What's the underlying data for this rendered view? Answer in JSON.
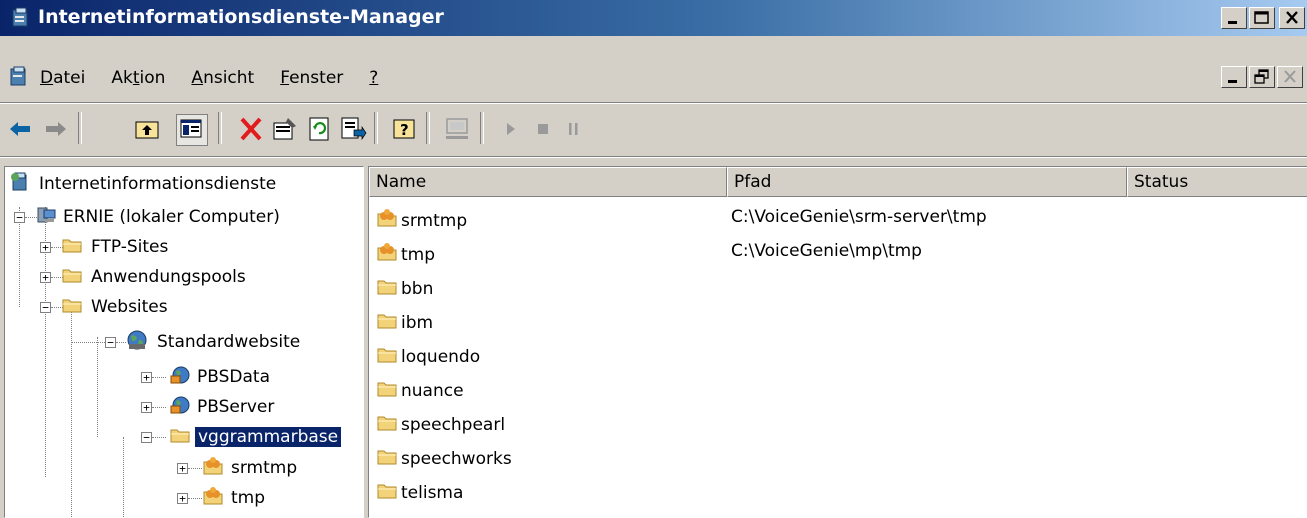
{
  "window": {
    "title": "Internetinformationsdienste-Manager"
  },
  "menubar": {
    "items": [
      {
        "label": "Datei",
        "accel": "D",
        "rest": "atei",
        "pre": ""
      },
      {
        "label": "Aktion",
        "pre": "Ak",
        "accel": "t",
        "rest": "ion"
      },
      {
        "label": "Ansicht",
        "pre": "",
        "accel": "A",
        "rest": "nsicht"
      },
      {
        "label": "Fenster",
        "pre": "",
        "accel": "F",
        "rest": "enster"
      },
      {
        "label": "?",
        "pre": "",
        "accel": "?",
        "rest": ""
      }
    ]
  },
  "toolbar": {
    "buttons": [
      "back-arrow-icon",
      "forward-arrow-icon",
      "up-folder-icon",
      "show-tree-icon",
      "delete-icon",
      "properties-icon",
      "refresh-icon",
      "export-list-icon",
      "help-icon",
      "connect-computer-icon",
      "start-icon",
      "stop-icon",
      "pause-icon"
    ]
  },
  "tree": {
    "root": "Internetinformationsdienste",
    "computer": "ERNIE (lokaler Computer)",
    "ftp": "FTP-Sites",
    "apppools": "Anwendungspools",
    "websites": "Websites",
    "default_site": "Standardwebsite",
    "pbsdata": "PBSData",
    "pbserver": "PBServer",
    "vggrammar": "vggrammarbase",
    "srmtmp": "srmtmp",
    "tmp": "tmp"
  },
  "list": {
    "columns": [
      "Name",
      "Pfad",
      "Status"
    ],
    "rows": [
      {
        "name": "srmtmp",
        "path": "C:\\VoiceGenie\\srm-server\\tmp",
        "status": "",
        "icon": "virtual-directory-icon"
      },
      {
        "name": "tmp",
        "path": "C:\\VoiceGenie\\mp\\tmp",
        "status": "",
        "icon": "virtual-directory-icon"
      },
      {
        "name": "bbn",
        "path": "",
        "status": "",
        "icon": "folder-icon"
      },
      {
        "name": "ibm",
        "path": "",
        "status": "",
        "icon": "folder-icon"
      },
      {
        "name": "loquendo",
        "path": "",
        "status": "",
        "icon": "folder-icon"
      },
      {
        "name": "nuance",
        "path": "",
        "status": "",
        "icon": "folder-icon"
      },
      {
        "name": "speechpearl",
        "path": "",
        "status": "",
        "icon": "folder-icon"
      },
      {
        "name": "speechworks",
        "path": "",
        "status": "",
        "icon": "folder-icon"
      },
      {
        "name": "telisma",
        "path": "",
        "status": "",
        "icon": "folder-icon"
      }
    ]
  },
  "colors": {
    "title_start": "#0a246a",
    "title_end": "#a6caf0",
    "face": "#d4d0c8",
    "selection": "#0a246a"
  }
}
